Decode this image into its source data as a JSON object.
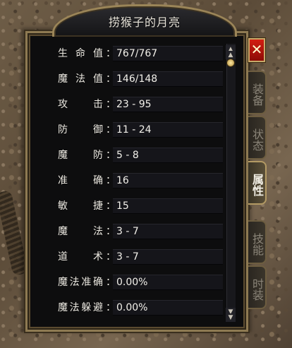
{
  "window": {
    "title": "捞猴子的月亮",
    "close_label": "✕"
  },
  "tabs": [
    {
      "label": "装备",
      "active": false
    },
    {
      "label": "状态",
      "active": false
    },
    {
      "label": "属性",
      "active": true
    },
    {
      "label": "技能",
      "active": false
    },
    {
      "label": "时装",
      "active": false
    }
  ],
  "colon": "：",
  "stats": [
    {
      "label": "生命值",
      "value": "767/767"
    },
    {
      "label": "魔法值",
      "value": "146/148"
    },
    {
      "label": "攻击",
      "value": "23 - 95"
    },
    {
      "label": "防御",
      "value": "11 - 24"
    },
    {
      "label": "魔防",
      "value": "5 - 8"
    },
    {
      "label": "准确",
      "value": "16"
    },
    {
      "label": "敏捷",
      "value": "15"
    },
    {
      "label": "魔法",
      "value": "3 - 7"
    },
    {
      "label": "道术",
      "value": "3 - 7"
    },
    {
      "label": "魔法准确",
      "value": "0.00%"
    },
    {
      "label": "魔法躲避",
      "value": "0.00%"
    }
  ],
  "scrollbar": {
    "up_glyph": "▲",
    "down_glyph": "▼"
  },
  "colors": {
    "frame_gold": "#8e7a52",
    "panel_bg": "#0d0d0e",
    "close_red": "#d31d12",
    "text": "#ebe8e0"
  }
}
